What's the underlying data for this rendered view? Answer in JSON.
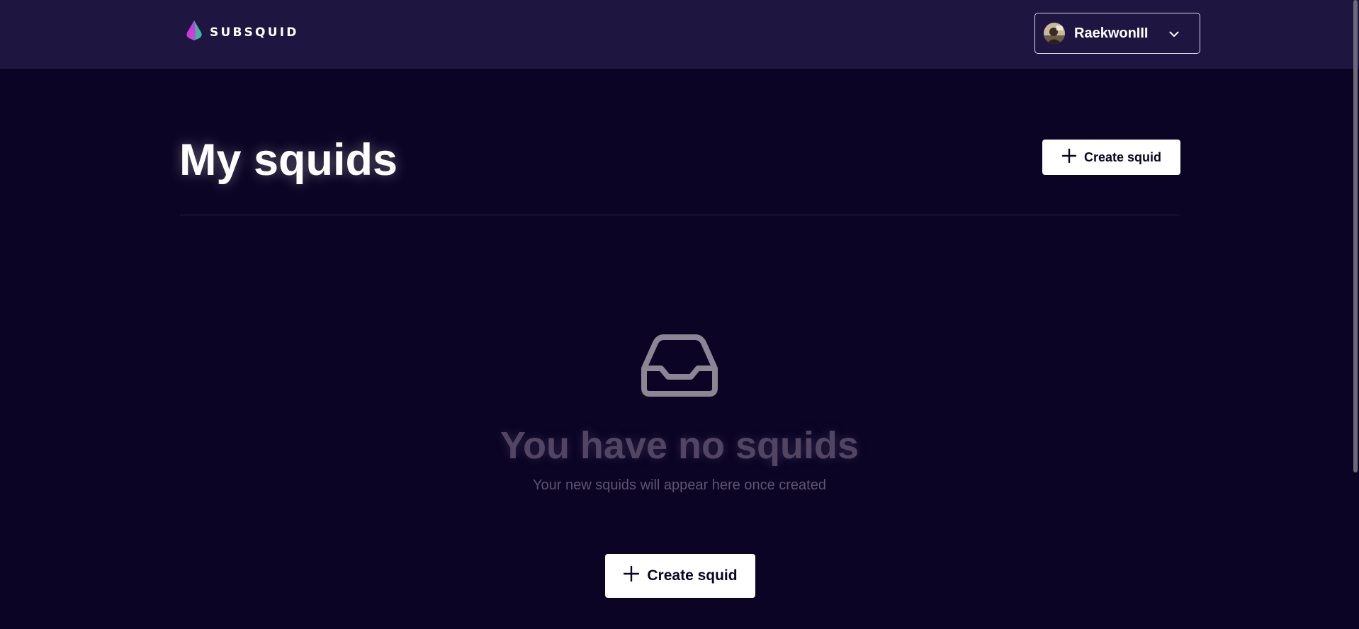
{
  "header": {
    "brand": "SUBSQUID",
    "logo_icon": "subsquid-logo-icon",
    "user": {
      "name": "RaekwonIII",
      "avatar_icon": "user-avatar",
      "menu_icon": "chevron-down-icon"
    }
  },
  "main": {
    "title": "My squids",
    "create_button_label": "Create squid",
    "create_button_icon": "plus-icon"
  },
  "empty_state": {
    "icon": "inbox-icon",
    "title": "You have no squids",
    "subtitle": "Your new squids will appear here once created",
    "create_button_label": "Create squid",
    "create_button_icon": "plus-icon"
  },
  "colors": {
    "background": "#0b0424",
    "topbar": "#1e1641",
    "button_bg": "#ffffff",
    "button_text": "#0b0424",
    "muted_title": "#514563",
    "muted_text": "#5c5470"
  }
}
